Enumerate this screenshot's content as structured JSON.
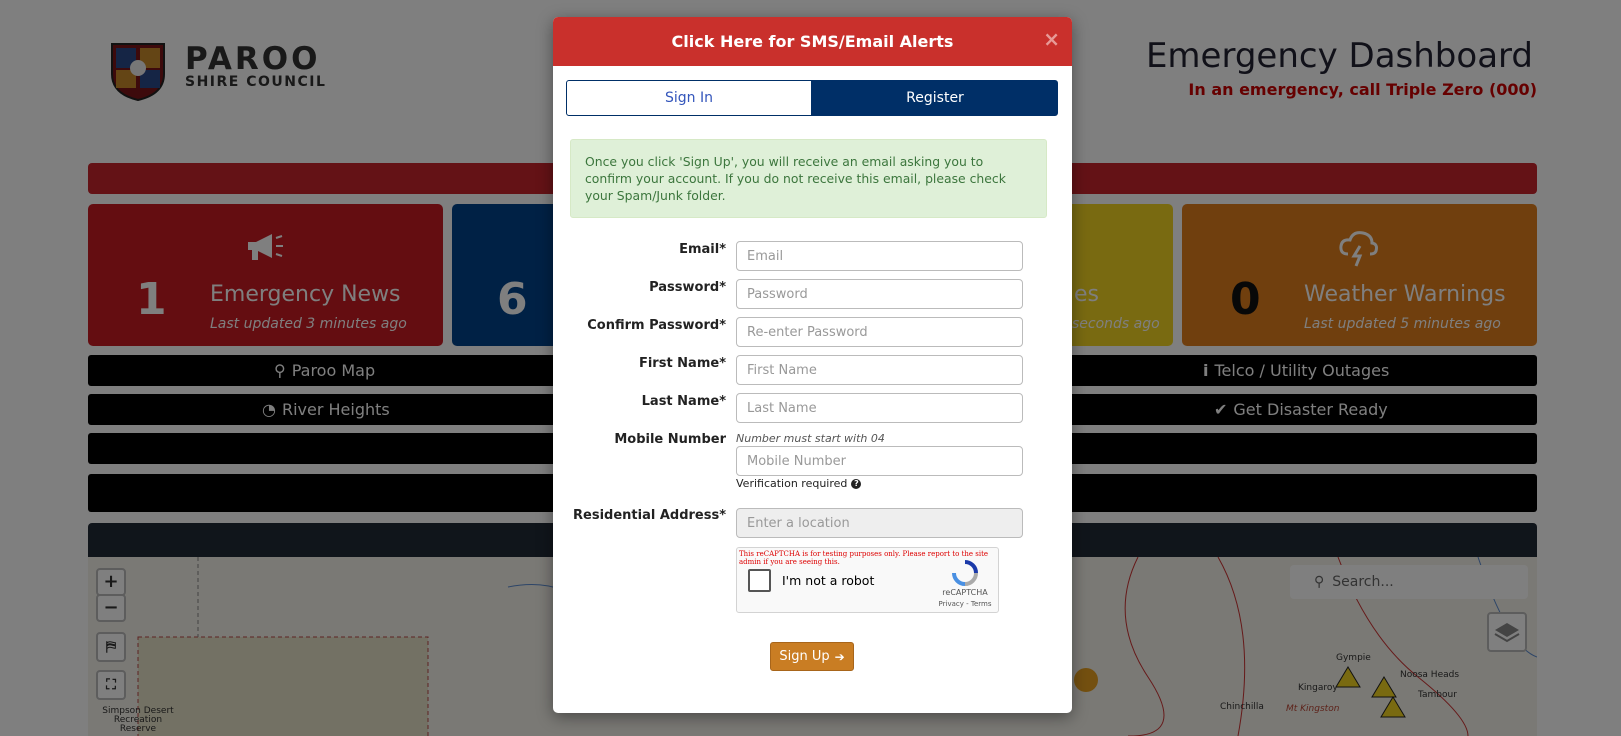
{
  "colors": {
    "emergency_red": "#9b1b20",
    "navy": "#002f67",
    "gold": "#d4b622",
    "orange": "#b56a20",
    "header_red": "#c9302c",
    "signup_orange": "#c97d23",
    "alert_green_bg": "#dff0d8"
  },
  "dashboard": {
    "logo": {
      "name": "PAROO",
      "sub": "SHIRE COUNCIL"
    },
    "title": "Emergency Dashboard",
    "emergency_call": "In an emergency, call Triple Zero (000)",
    "tiles": [
      {
        "count": "1",
        "label": "Emergency News",
        "updated": "Last updated 3 minutes ago",
        "icon": "megaphone-icon"
      },
      {
        "count": "6",
        "icon": "road-icon"
      },
      {
        "label_fragment": "ges",
        "updated_fragment": "seconds ago"
      },
      {
        "count": "0",
        "label": "Weather Warnings",
        "updated": "Last updated 5 minutes ago",
        "icon": "storm-cloud-icon"
      }
    ],
    "nav": [
      {
        "label": "Paroo Map",
        "icon": "map-marker-icon"
      },
      {
        "label": "Telco / Utility Outages",
        "icon": "info-icon"
      },
      {
        "label": "River Heights",
        "icon": "gauge-icon"
      },
      {
        "label": "Get Disaster Ready",
        "icon": "check-icon"
      }
    ],
    "map": {
      "search_placeholder": "Search...",
      "zoom_in": "+",
      "zoom_out": "−",
      "towns": [
        "Gympie",
        "Noosa Heads",
        "Kingaroy",
        "Tambour",
        "Chinchilla",
        "Mt Kingston"
      ],
      "park_label": "Simpson Desert Recreation Reserve"
    }
  },
  "modal": {
    "header": "Click Here for SMS/Email Alerts",
    "close": "×",
    "tabs": {
      "signin": "Sign In",
      "register": "Register"
    },
    "info": "Once you click 'Sign Up', you will receive an email asking you to confirm your account. If you do not receive this email, please check your Spam/Junk folder.",
    "fields": {
      "email": {
        "label": "Email*",
        "placeholder": "Email"
      },
      "password": {
        "label": "Password*",
        "placeholder": "Password"
      },
      "confirm": {
        "label": "Confirm Password*",
        "placeholder": "Re-enter Password"
      },
      "first": {
        "label": "First Name*",
        "placeholder": "First Name"
      },
      "last": {
        "label": "Last Name*",
        "placeholder": "Last Name"
      },
      "mobile": {
        "label": "Mobile Number",
        "hint": "Number must start with 04",
        "placeholder": "Mobile Number",
        "verification": "Verification required"
      },
      "address": {
        "label": "Residential Address*",
        "placeholder": "Enter a location"
      }
    },
    "captcha": {
      "warning": "This reCAPTCHA is for testing purposes only. Please report to the site admin if you are seeing this.",
      "label": "I'm not a robot",
      "brand": "reCAPTCHA",
      "links": "Privacy - Terms"
    },
    "signup": "Sign Up"
  }
}
